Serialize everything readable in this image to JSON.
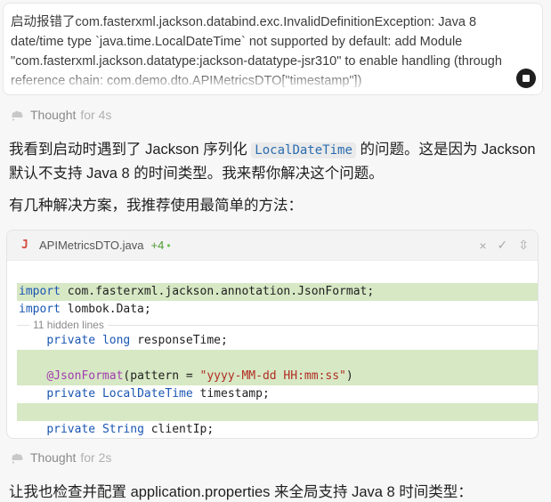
{
  "user_message": {
    "text": "启动报错了com.fasterxml.jackson.databind.exc.InvalidDefinitionException: Java 8 date/time type `java.time.LocalDateTime` not supported by default: add Module \"com.fasterxml.jackson.datatype:jackson-datatype-jsr310\" to enable handling (through reference chain: com.demo.dto.APIMetricsDTO[\"timestamp\"])",
    "stop_icon": "stop-icon"
  },
  "thought1": {
    "label": "Thought",
    "duration": "for 4s"
  },
  "reply": {
    "para1_a": "我看到启动时遇到了 Jackson 序列化 ",
    "para1_code": "LocalDateTime",
    "para1_b": " 的问题。这是因为 Jackson 默认不支持 Java 8 的时间类型。我来帮你解决这个问题。",
    "para2": "有几种解决方案，我推荐使用最简单的方法："
  },
  "code_card": {
    "file_icon": "J",
    "file_name": "APIMetricsDTO.java",
    "adds": "+4",
    "dot": "•",
    "actions": {
      "reject": "×",
      "accept": "✓",
      "expand": "⇳"
    },
    "lines": {
      "import1_kw": "import",
      "import1_rest": " com.fasterxml.jackson.annotation.JsonFormat;",
      "import2_kw": "import",
      "import2_rest": " lombok.Data;",
      "hidden": "11 hidden lines",
      "resp_mod": "private",
      "resp_type": "long",
      "resp_rest": " responseTime;",
      "anno_at": "@",
      "anno_name": "JsonFormat",
      "anno_pre": "(pattern = ",
      "anno_str": "\"yyyy-MM-dd HH:mm:ss\"",
      "anno_post": ")",
      "ts_mod": "private",
      "ts_type": "LocalDateTime",
      "ts_rest": " timestamp;",
      "ci_mod": "private",
      "ci_type": "String",
      "ci_rest": " clientIp;"
    }
  },
  "thought2": {
    "label": "Thought",
    "duration": "for 2s"
  },
  "reply2": {
    "para": "让我也检查并配置 application.properties 来全局支持 Java 8 时间类型："
  }
}
